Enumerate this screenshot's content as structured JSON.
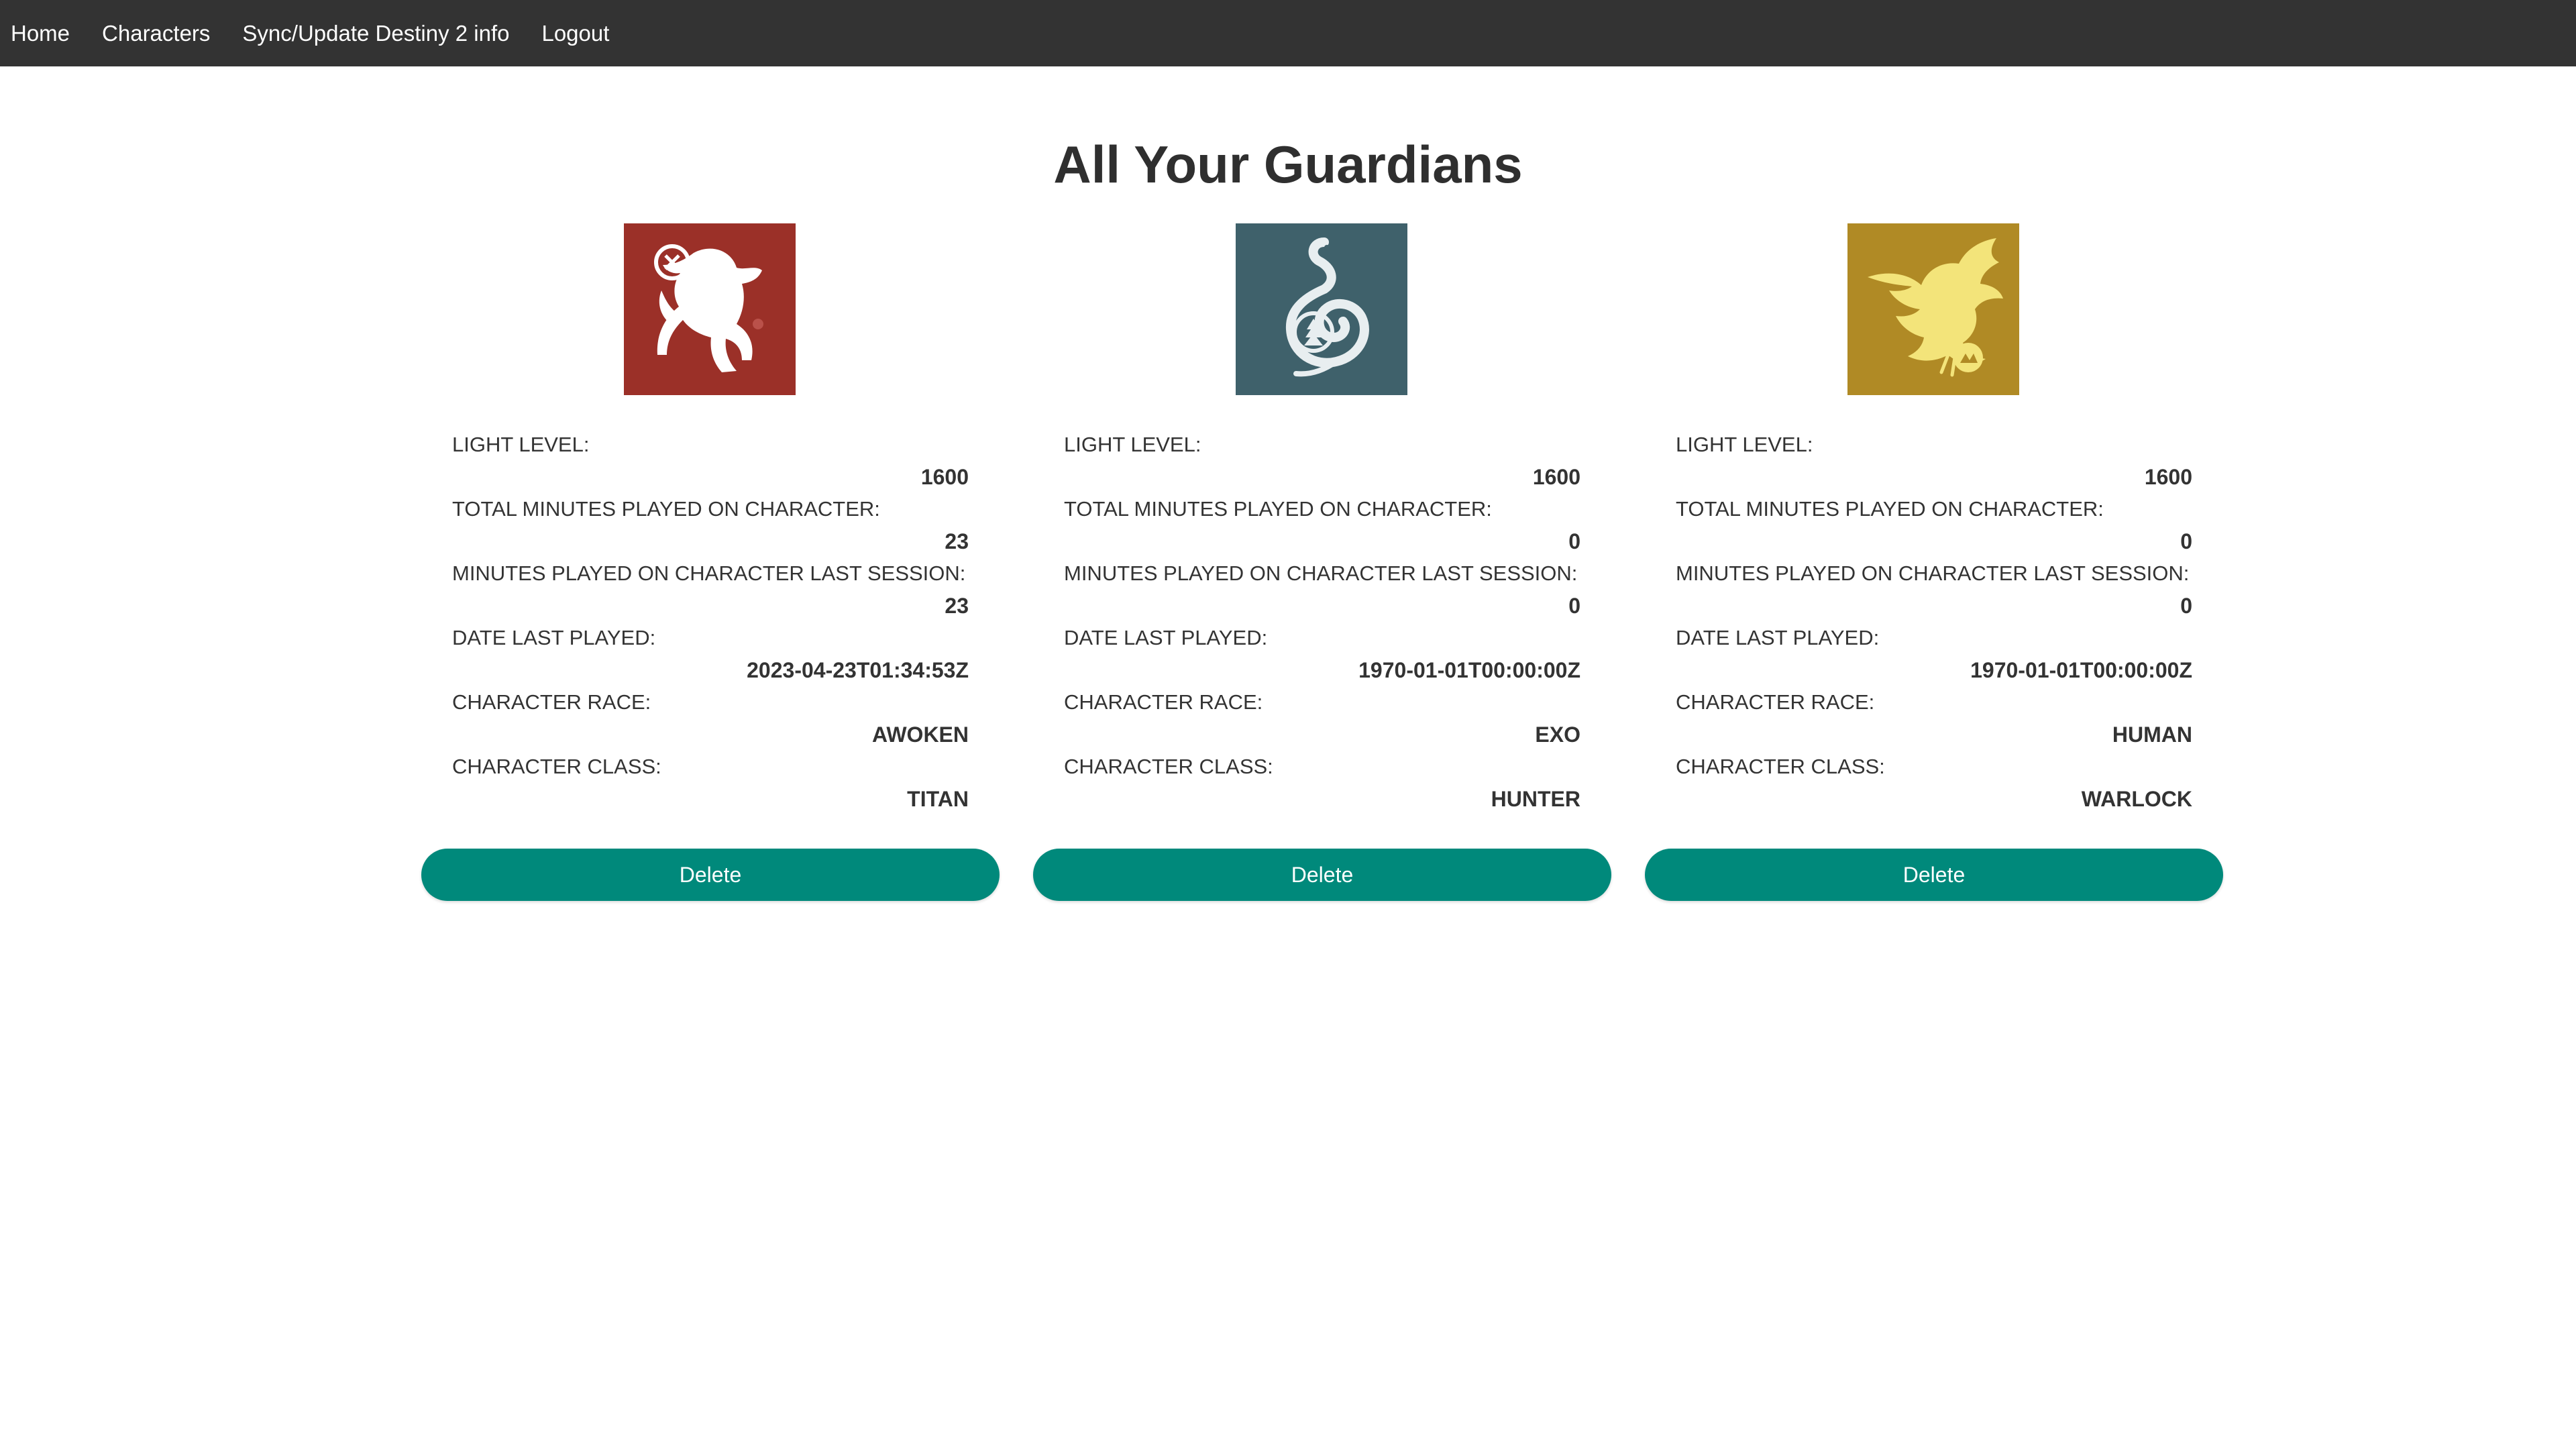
{
  "nav": {
    "items": [
      {
        "label": "Home"
      },
      {
        "label": "Characters"
      },
      {
        "label": "Sync/Update Destiny 2 info"
      },
      {
        "label": "Logout"
      }
    ]
  },
  "page": {
    "title": "All Your Guardians"
  },
  "labels": {
    "light_level": "LIGHT LEVEL:",
    "total_minutes": "TOTAL MINUTES PLAYED ON CHARACTER:",
    "last_session": "MINUTES PLAYED ON CHARACTER LAST SESSION:",
    "date_last_played": "DATE LAST PLAYED:",
    "race": "CHARACTER RACE:",
    "class": "CHARACTER CLASS:"
  },
  "characters": [
    {
      "emblem": {
        "icon": "lion-rampant-emblem-icon",
        "color": "#9b3028"
      },
      "light_level": "1600",
      "total_minutes": "23",
      "last_session": "23",
      "date_last_played": "2023-04-23T01:34:53Z",
      "race": "AWOKEN",
      "class": "TITAN",
      "delete_label": "Delete"
    },
    {
      "emblem": {
        "icon": "serpent-emblem-icon",
        "color": "#3f616b"
      },
      "light_level": "1600",
      "total_minutes": "0",
      "last_session": "0",
      "date_last_played": "1970-01-01T00:00:00Z",
      "race": "EXO",
      "class": "HUNTER",
      "delete_label": "Delete"
    },
    {
      "emblem": {
        "icon": "eagle-emblem-icon",
        "color": "#b08a25"
      },
      "light_level": "1600",
      "total_minutes": "0",
      "last_session": "0",
      "date_last_played": "1970-01-01T00:00:00Z",
      "race": "HUMAN",
      "class": "WARLOCK",
      "delete_label": "Delete"
    }
  ],
  "colors": {
    "navbar": "#333333",
    "accent": "#00897b"
  }
}
